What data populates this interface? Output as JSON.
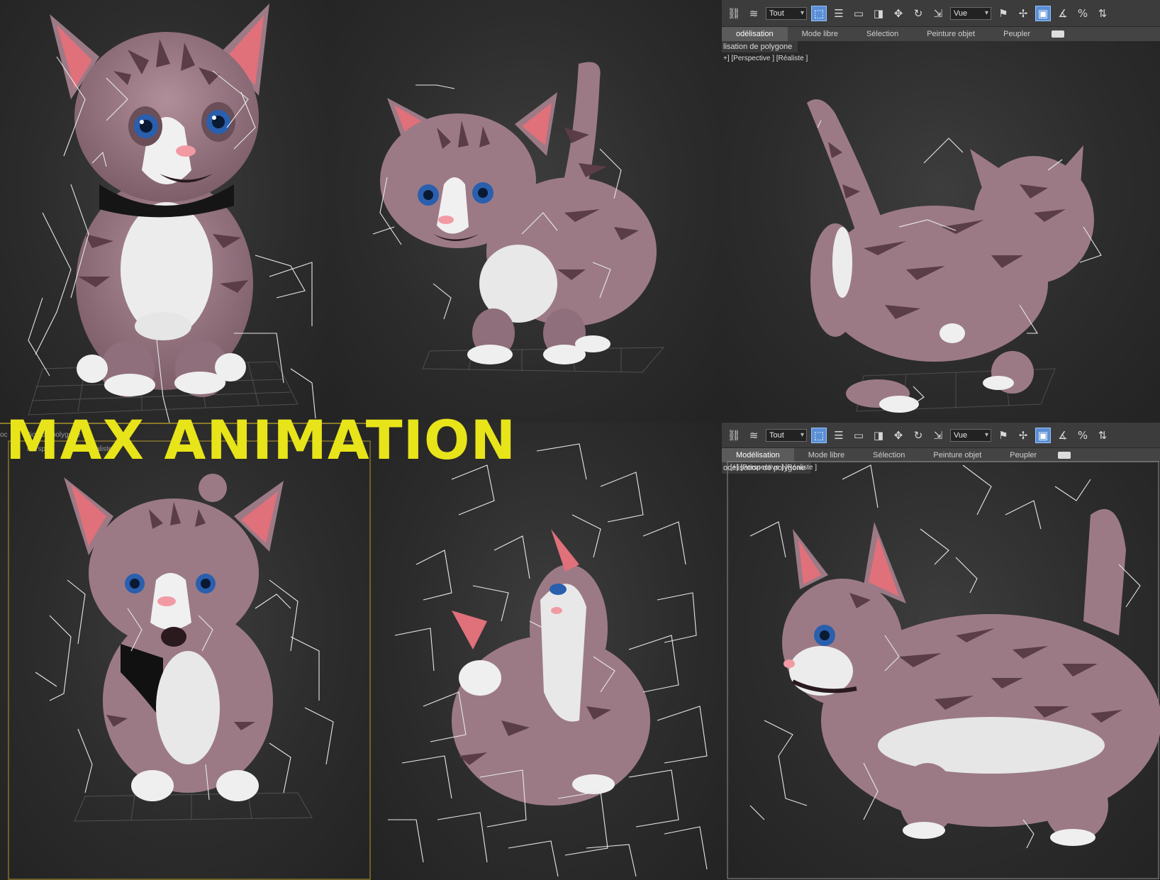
{
  "headline": "MAX ANIMATION",
  "toolbar": {
    "select_filter": "Tout",
    "coordinate_system": "Vue"
  },
  "ribbon_tabs": [
    "Modélisation",
    "Mode libre",
    "Sélection",
    "Peinture objet",
    "Peupler"
  ],
  "ribbon_tabs_clipped_top": "odélisation",
  "subtab_clipped_top": "lisation de polygone",
  "subtab_clipped_bottom": "odélisation de polygone",
  "viewport_label": {
    "plus": "[+]",
    "view": "[Perspective ]",
    "shading": "[Réaliste ]"
  },
  "ghost_texts": {
    "left_fragment": "oc",
    "poly_fragment": "tion de polygone",
    "persp_fragment": "Perspec",
    "realiste_fragment": "aliste"
  },
  "colors": {
    "headline": "#e8e41a",
    "cat_fur": "#9b7a86",
    "cat_stripes": "#5a3d47",
    "cat_white": "#ececec",
    "ear_inner": "#e0707a",
    "eye": "#2a5fae",
    "active_tool": "#5a8fd6"
  },
  "icons": [
    "link-icon",
    "unlink-icon",
    "select-object-icon",
    "select-by-name-icon",
    "rect-region-icon",
    "window-crossing-icon",
    "move-icon",
    "rotate-icon",
    "scale-icon",
    "named-selection-icon",
    "pivot-icon",
    "snap-icon",
    "angle-snap-icon",
    "percent-snap-icon",
    "spinner-snap-icon"
  ]
}
